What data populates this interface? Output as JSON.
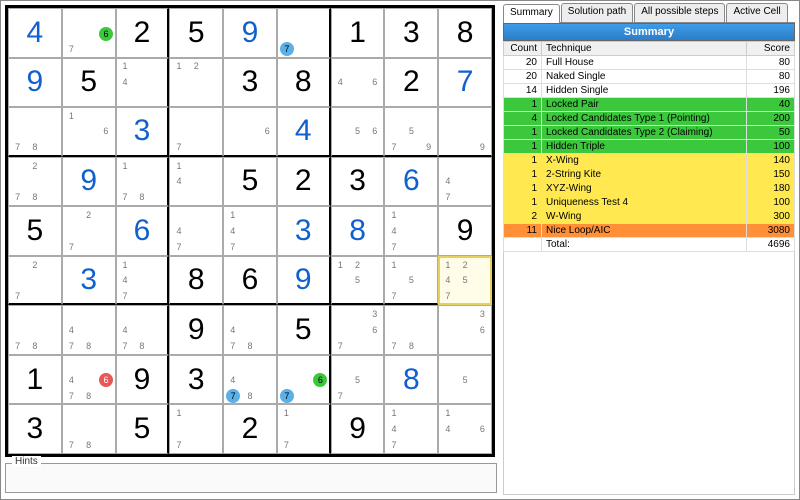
{
  "tabs": {
    "summary": "Summary",
    "solution": "Solution path",
    "all": "All possible steps",
    "active": "Active Cell"
  },
  "panel_title": "Summary",
  "headers": {
    "count": "Count",
    "technique": "Technique",
    "score": "Score"
  },
  "hints_label": "Hints",
  "techniques": [
    {
      "count": 20,
      "name": "Full House",
      "score": 80,
      "cls": ""
    },
    {
      "count": 20,
      "name": "Naked Single",
      "score": 80,
      "cls": ""
    },
    {
      "count": 14,
      "name": "Hidden Single",
      "score": 196,
      "cls": ""
    },
    {
      "count": 1,
      "name": "Locked Pair",
      "score": 40,
      "cls": "row-green"
    },
    {
      "count": 4,
      "name": "Locked Candidates Type 1 (Pointing)",
      "score": 200,
      "cls": "row-green"
    },
    {
      "count": 1,
      "name": "Locked Candidates Type 2 (Claiming)",
      "score": 50,
      "cls": "row-green"
    },
    {
      "count": 1,
      "name": "Hidden Triple",
      "score": 100,
      "cls": "row-green"
    },
    {
      "count": 1,
      "name": "X-Wing",
      "score": 140,
      "cls": "row-yellow"
    },
    {
      "count": 1,
      "name": "2-String Kite",
      "score": 150,
      "cls": "row-yellow"
    },
    {
      "count": 1,
      "name": "XYZ-Wing",
      "score": 180,
      "cls": "row-yellow"
    },
    {
      "count": 1,
      "name": "Uniqueness Test 4",
      "score": 100,
      "cls": "row-yellow"
    },
    {
      "count": 2,
      "name": "W-Wing",
      "score": 300,
      "cls": "row-yellow"
    },
    {
      "count": 11,
      "name": "Nice Loop/AIC",
      "score": 3080,
      "cls": "row-orange"
    }
  ],
  "total_label": "Total:",
  "total": 4696,
  "sudoku": {
    "rows": [
      [
        {
          "big": "4",
          "t": "s"
        },
        {
          "hl": [
            {
              "n": "6",
              "c": "green",
              "p": 6
            }
          ],
          "c": [
            7
          ]
        },
        {
          "big": "2",
          "t": "g"
        },
        {
          "big": "5",
          "t": "g"
        },
        {
          "big": "9",
          "t": "s"
        },
        {
          "hl": [
            {
              "n": "7",
              "c": "blue",
              "p": 7
            }
          ]
        },
        {
          "big": "1",
          "t": "g"
        },
        {
          "big": "3",
          "t": "g"
        },
        {
          "big": "8",
          "t": "g"
        }
      ],
      [
        {
          "big": "9",
          "t": "s"
        },
        {
          "big": "5",
          "t": "g"
        },
        {
          "c": [
            1,
            4
          ]
        },
        {
          "c": [
            1,
            2
          ]
        },
        {
          "big": "3",
          "t": "g"
        },
        {
          "big": "8",
          "t": "g"
        },
        {
          "c": [
            4,
            6
          ]
        },
        {
          "big": "2",
          "t": "g"
        },
        {
          "big": "7",
          "t": "s"
        }
      ],
      [
        {
          "c": [
            7,
            8
          ]
        },
        {
          "c": [
            1,
            6
          ]
        },
        {
          "big": "3",
          "t": "s"
        },
        {
          "c": [
            7
          ]
        },
        {
          "c": [
            6
          ]
        },
        {
          "big": "4",
          "t": "s"
        },
        {
          "c": [
            5,
            6
          ]
        },
        {
          "c": [
            5,
            7,
            9
          ]
        },
        {
          "c": [
            9
          ]
        }
      ],
      [
        {
          "c": [
            2,
            7,
            8
          ]
        },
        {
          "big": "9",
          "t": "s"
        },
        {
          "c": [
            1,
            7,
            8
          ]
        },
        {
          "c": [
            1,
            4
          ]
        },
        {
          "big": "5",
          "t": "g"
        },
        {
          "big": "2",
          "t": "g"
        },
        {
          "big": "3",
          "t": "g"
        },
        {
          "big": "6",
          "t": "s"
        },
        {
          "c": [
            4,
            7
          ]
        }
      ],
      [
        {
          "big": "5",
          "t": "g"
        },
        {
          "c": [
            2,
            7
          ]
        },
        {
          "big": "6",
          "t": "s"
        },
        {
          "c": [
            4,
            7
          ]
        },
        {
          "c": [
            1,
            4,
            7
          ]
        },
        {
          "big": "3",
          "t": "s"
        },
        {
          "big": "8",
          "t": "s"
        },
        {
          "c": [
            1,
            4,
            7
          ]
        },
        {
          "big": "9",
          "t": "g"
        }
      ],
      [
        {
          "c": [
            2,
            7
          ]
        },
        {
          "big": "3",
          "t": "s"
        },
        {
          "c": [
            1,
            4,
            7
          ]
        },
        {
          "big": "8",
          "t": "g"
        },
        {
          "big": "6",
          "t": "g"
        },
        {
          "big": "9",
          "t": "s"
        },
        {
          "c": [
            1,
            2,
            5
          ]
        },
        {
          "c": [
            1,
            5,
            7
          ]
        },
        {
          "c": [
            1,
            2,
            5,
            4,
            7
          ],
          "sel": true
        }
      ],
      [
        {
          "c": [
            7,
            8
          ]
        },
        {
          "c": [
            4,
            7,
            8
          ]
        },
        {
          "c": [
            4,
            7,
            8
          ]
        },
        {
          "big": "9",
          "t": "g"
        },
        {
          "c": [
            4,
            7,
            8
          ]
        },
        {
          "big": "5",
          "t": "g"
        },
        {
          "c": [
            3,
            6,
            7
          ]
        },
        {
          "c": [
            7,
            8
          ]
        },
        {
          "c": [
            3,
            6
          ]
        }
      ],
      [
        {
          "big": "1",
          "t": "g"
        },
        {
          "c": [
            4,
            7,
            8
          ],
          "hl": [
            {
              "n": "6",
              "c": "red",
              "p": 6
            }
          ]
        },
        {
          "big": "9",
          "t": "g"
        },
        {
          "big": "3",
          "t": "g"
        },
        {
          "c": [
            4,
            8
          ],
          "hl": [
            {
              "n": "7",
              "c": "blue",
              "p": 7
            }
          ]
        },
        {
          "hl": [
            {
              "n": "6",
              "c": "green",
              "p": 6
            },
            {
              "n": "7",
              "c": "blue",
              "p": 7
            }
          ]
        },
        {
          "c": [
            5,
            7
          ]
        },
        {
          "big": "8",
          "t": "s"
        },
        {
          "c": [
            5
          ]
        }
      ],
      [
        {
          "big": "3",
          "t": "g"
        },
        {
          "c": [
            7,
            8
          ]
        },
        {
          "big": "5",
          "t": "g"
        },
        {
          "c": [
            1,
            7
          ]
        },
        {
          "big": "2",
          "t": "g"
        },
        {
          "c": [
            1,
            7
          ]
        },
        {
          "big": "9",
          "t": "g"
        },
        {
          "c": [
            1,
            4,
            7
          ]
        },
        {
          "c": [
            1,
            4,
            6
          ]
        }
      ]
    ]
  }
}
